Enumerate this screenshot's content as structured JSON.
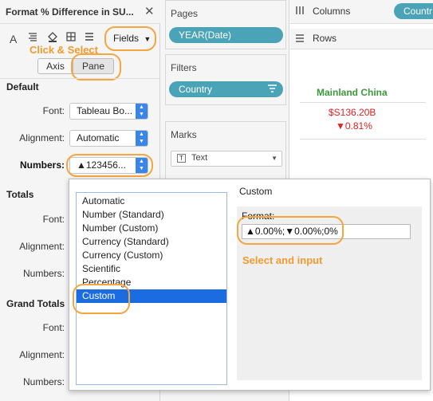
{
  "format_pane": {
    "title": "Format % Difference in SU...",
    "close_glyph": "✕",
    "toolbar_icons": [
      "font-icon",
      "alignment-icon",
      "shading-icon",
      "borders-icon",
      "lines-icon"
    ],
    "fields_label": "Fields",
    "annotation_click_select": "Click & Select",
    "tabs": [
      {
        "label": "Axis"
      },
      {
        "label": "Pane"
      }
    ],
    "default_section": {
      "heading": "Default",
      "font_label": "Font:",
      "font_value": "Tableau Bo...",
      "alignment_label": "Alignment:",
      "alignment_value": "Automatic",
      "numbers_label": "Numbers:",
      "numbers_value": "▲123456..."
    },
    "totals_section": {
      "heading": "Totals",
      "font_label": "Font:",
      "alignment_label": "Alignment:",
      "numbers_label": "Numbers:"
    },
    "grand_totals_section": {
      "heading": "Grand Totals",
      "font_label": "Font:",
      "alignment_label": "Alignment:",
      "numbers_label": "Numbers:"
    }
  },
  "shelves": {
    "pages_title": "Pages",
    "pages_pill": "YEAR(Date)",
    "filters_title": "Filters",
    "filters_pill": "Country",
    "marks_title": "Marks",
    "marks_type": "Text",
    "columns_label": "Columns",
    "columns_pill": "Countr",
    "rows_label": "Rows"
  },
  "viz": {
    "header": "Mainland China",
    "value": "$S136.20B",
    "diff": "▼0.81%",
    "colors": {
      "header": "#3a9a3a",
      "value": "#e02020"
    }
  },
  "popup": {
    "number_formats": [
      "Automatic",
      "Number (Standard)",
      "Number (Custom)",
      "Currency (Standard)",
      "Currency (Custom)",
      "Scientific",
      "Percentage",
      "Custom"
    ],
    "selected_format": "Custom",
    "custom_title": "Custom",
    "format_label": "Format:",
    "format_value": "▲0.00%;▼0.00%;0%",
    "annotation_select_input": "Select and input"
  },
  "colors": {
    "accent": "#1a6ce0",
    "pill": "#4aa3b6",
    "annotation": "#f29a2e"
  }
}
